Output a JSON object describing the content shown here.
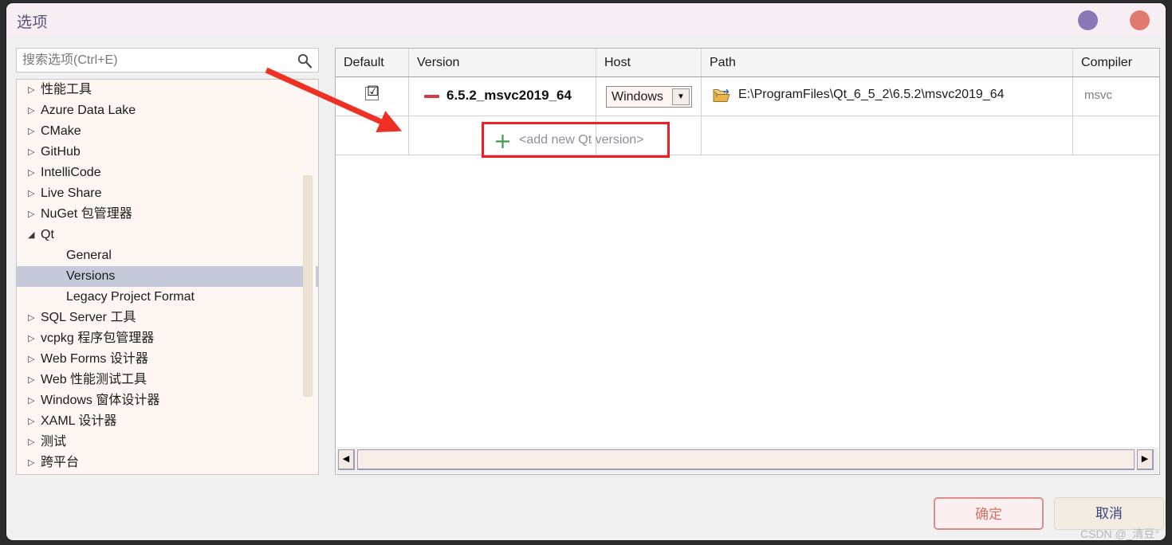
{
  "window": {
    "title": "选项",
    "minimize_dot_color": "#8a77b8",
    "close_dot_color": "#e0796e"
  },
  "search": {
    "placeholder": "搜索选项(Ctrl+E)",
    "value": "",
    "icon": "search-icon"
  },
  "sidebar": {
    "items": [
      {
        "label": "性能工具",
        "arrow": "▷",
        "level": 0,
        "selected": false
      },
      {
        "label": "Azure Data Lake",
        "arrow": "▷",
        "level": 0,
        "selected": false
      },
      {
        "label": "CMake",
        "arrow": "▷",
        "level": 0,
        "selected": false
      },
      {
        "label": "GitHub",
        "arrow": "▷",
        "level": 0,
        "selected": false
      },
      {
        "label": "IntelliCode",
        "arrow": "▷",
        "level": 0,
        "selected": false
      },
      {
        "label": "Live Share",
        "arrow": "▷",
        "level": 0,
        "selected": false
      },
      {
        "label": "NuGet 包管理器",
        "arrow": "▷",
        "level": 0,
        "selected": false
      },
      {
        "label": "Qt",
        "arrow": "◢",
        "level": 0,
        "selected": false
      },
      {
        "label": "General",
        "arrow": "",
        "level": 1,
        "selected": false
      },
      {
        "label": "Versions",
        "arrow": "",
        "level": 1,
        "selected": true
      },
      {
        "label": "Legacy Project Format",
        "arrow": "",
        "level": 1,
        "selected": false
      },
      {
        "label": "SQL Server 工具",
        "arrow": "▷",
        "level": 0,
        "selected": false
      },
      {
        "label": "vcpkg 程序包管理器",
        "arrow": "▷",
        "level": 0,
        "selected": false
      },
      {
        "label": "Web Forms 设计器",
        "arrow": "▷",
        "level": 0,
        "selected": false
      },
      {
        "label": "Web 性能测试工具",
        "arrow": "▷",
        "level": 0,
        "selected": false
      },
      {
        "label": "Windows 窗体设计器",
        "arrow": "▷",
        "level": 0,
        "selected": false
      },
      {
        "label": "XAML 设计器",
        "arrow": "▷",
        "level": 0,
        "selected": false
      },
      {
        "label": "测试",
        "arrow": "▷",
        "level": 0,
        "selected": false
      },
      {
        "label": "跨平台",
        "arrow": "▷",
        "level": 0,
        "selected": false
      }
    ],
    "selection_color": "#c6c9da"
  },
  "table": {
    "columns": [
      "Default",
      "Version",
      "Host",
      "Path",
      "Compiler"
    ],
    "rows": [
      {
        "default_checked": "☑",
        "version": "6.5.2_msvc2019_64",
        "host": "Windows",
        "path": "E:\\ProgramFiles\\Qt_6_5_2\\6.5.2\\msvc2019_64",
        "compiler": "msvc",
        "remove_icon": "minus-icon",
        "folder_icon": "folder-open-icon",
        "dropdown_arrow": "▼"
      }
    ],
    "add_row": {
      "label": "<add new Qt version>",
      "plus_icon": "plus-icon",
      "highlight_color": "#ec2024"
    },
    "hscroll": {
      "left_arrow": "◀",
      "right_arrow": "▶"
    }
  },
  "footer": {
    "ok_label": "确定",
    "cancel_label": "取消",
    "ok_border_color": "#d78f8c",
    "ok_text_color": "#d1716c"
  },
  "annotation": {
    "arrow_color": "#ee3124"
  },
  "watermark": {
    "text": "CSDN @_清豆°"
  }
}
